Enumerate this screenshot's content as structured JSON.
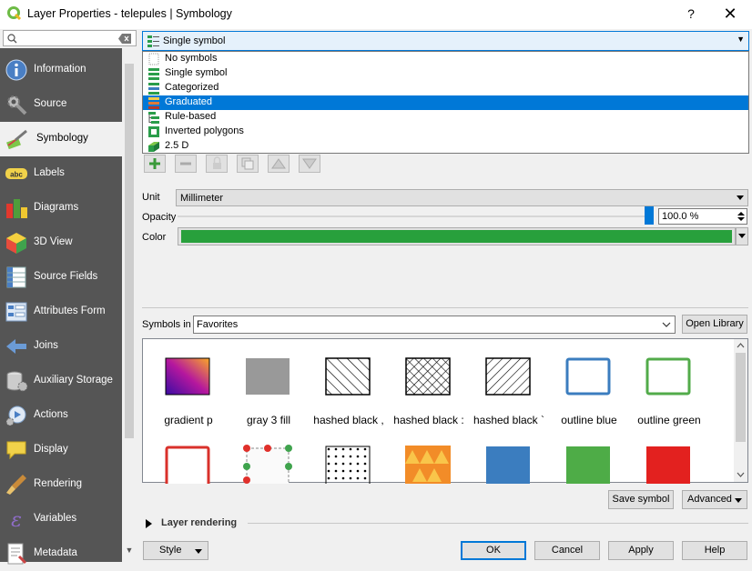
{
  "window": {
    "title": "Layer Properties - telepules | Symbology",
    "help": "?",
    "close": "✕"
  },
  "search": {
    "placeholder": ""
  },
  "sidebar": {
    "items": [
      {
        "label": "Information"
      },
      {
        "label": "Source"
      },
      {
        "label": "Symbology"
      },
      {
        "label": "Labels"
      },
      {
        "label": "Diagrams"
      },
      {
        "label": "3D View"
      },
      {
        "label": "Source Fields"
      },
      {
        "label": "Attributes Form"
      },
      {
        "label": "Joins"
      },
      {
        "label": "Auxiliary Storage"
      },
      {
        "label": "Actions"
      },
      {
        "label": "Display"
      },
      {
        "label": "Rendering"
      },
      {
        "label": "Variables"
      },
      {
        "label": "Metadata"
      }
    ]
  },
  "renderer": {
    "selected": "Single symbol",
    "options": [
      "No symbols",
      "Single symbol",
      "Categorized",
      "Graduated",
      "Rule-based",
      "Inverted polygons",
      "2.5 D"
    ],
    "highlighted": "Graduated"
  },
  "symbol": {
    "unit_label": "Unit",
    "unit_value": "Millimeter",
    "opacity_label": "Opacity",
    "opacity_value": "100.0 %",
    "opacity_level": 1.0,
    "color_label": "Color",
    "color_value": "#28a03c"
  },
  "library": {
    "symbols_in_label": "Symbols in",
    "group": "Favorites",
    "open_library": "Open Library",
    "symbols": [
      {
        "name": "gradient  p"
      },
      {
        "name": "gray 3 fill"
      },
      {
        "name": "hashed black ,"
      },
      {
        "name": "hashed black :"
      },
      {
        "name": "hashed black `"
      },
      {
        "name": "outline blue"
      },
      {
        "name": "outline green"
      }
    ],
    "save_symbol": "Save symbol",
    "advanced": "Advanced"
  },
  "layer_rendering": "Layer rendering",
  "buttons": {
    "style": "Style",
    "ok": "OK",
    "cancel": "Cancel",
    "apply": "Apply",
    "help": "Help"
  }
}
